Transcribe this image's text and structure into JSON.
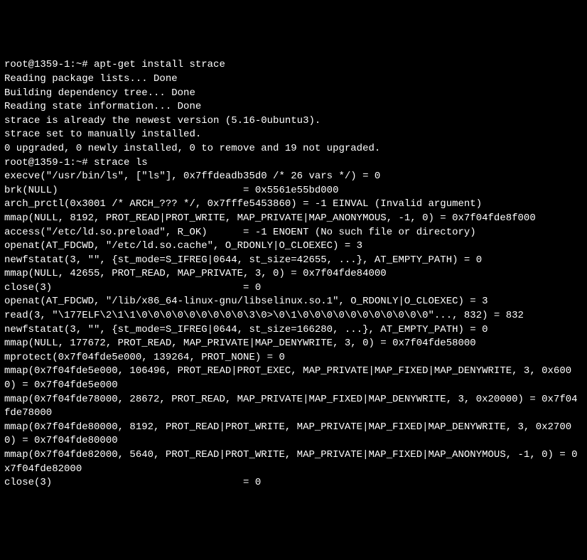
{
  "lines": [
    "root@1359-1:~# apt-get install strace",
    "Reading package lists... Done",
    "Building dependency tree... Done",
    "Reading state information... Done",
    "strace is already the newest version (5.16-0ubuntu3).",
    "strace set to manually installed.",
    "0 upgraded, 0 newly installed, 0 to remove and 19 not upgraded.",
    "root@1359-1:~# strace ls",
    "execve(\"/usr/bin/ls\", [\"ls\"], 0x7ffdeadb35d0 /* 26 vars */) = 0",
    "brk(NULL)                               = 0x5561e55bd000",
    "arch_prctl(0x3001 /* ARCH_??? */, 0x7fffe5453860) = -1 EINVAL (Invalid argument)",
    "mmap(NULL, 8192, PROT_READ|PROT_WRITE, MAP_PRIVATE|MAP_ANONYMOUS, -1, 0) = 0x7f04fde8f000",
    "access(\"/etc/ld.so.preload\", R_OK)      = -1 ENOENT (No such file or directory)",
    "openat(AT_FDCWD, \"/etc/ld.so.cache\", O_RDONLY|O_CLOEXEC) = 3",
    "newfstatat(3, \"\", {st_mode=S_IFREG|0644, st_size=42655, ...}, AT_EMPTY_PATH) = 0",
    "mmap(NULL, 42655, PROT_READ, MAP_PRIVATE, 3, 0) = 0x7f04fde84000",
    "close(3)                                = 0",
    "openat(AT_FDCWD, \"/lib/x86_64-linux-gnu/libselinux.so.1\", O_RDONLY|O_CLOEXEC) = 3",
    "read(3, \"\\177ELF\\2\\1\\1\\0\\0\\0\\0\\0\\0\\0\\0\\0\\3\\0>\\0\\1\\0\\0\\0\\0\\0\\0\\0\\0\\0\\0\\0\"..., 832) = 832",
    "newfstatat(3, \"\", {st_mode=S_IFREG|0644, st_size=166280, ...}, AT_EMPTY_PATH) = 0",
    "mmap(NULL, 177672, PROT_READ, MAP_PRIVATE|MAP_DENYWRITE, 3, 0) = 0x7f04fde58000",
    "mprotect(0x7f04fde5e000, 139264, PROT_NONE) = 0",
    "mmap(0x7f04fde5e000, 106496, PROT_READ|PROT_EXEC, MAP_PRIVATE|MAP_FIXED|MAP_DENYWRITE, 3, 0x6000) = 0x7f04fde5e000",
    "mmap(0x7f04fde78000, 28672, PROT_READ, MAP_PRIVATE|MAP_FIXED|MAP_DENYWRITE, 3, 0x20000) = 0x7f04fde78000",
    "mmap(0x7f04fde80000, 8192, PROT_READ|PROT_WRITE, MAP_PRIVATE|MAP_FIXED|MAP_DENYWRITE, 3, 0x27000) = 0x7f04fde80000",
    "mmap(0x7f04fde82000, 5640, PROT_READ|PROT_WRITE, MAP_PRIVATE|MAP_FIXED|MAP_ANONYMOUS, -1, 0) = 0x7f04fde82000",
    "close(3)                                = 0"
  ]
}
